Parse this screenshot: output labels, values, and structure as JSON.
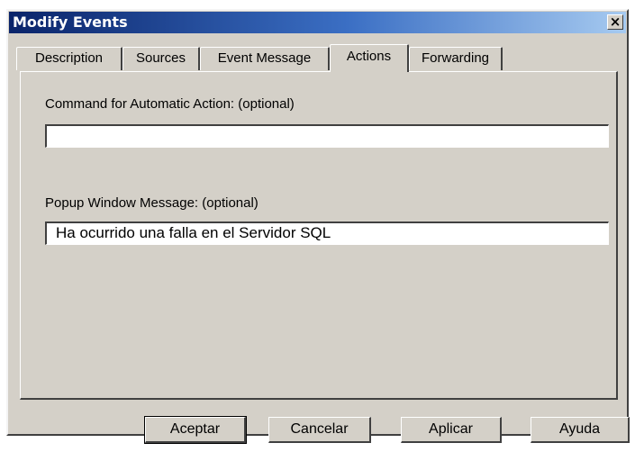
{
  "window": {
    "title": "Modify Events",
    "close_glyph": "×"
  },
  "tabs": [
    {
      "label": "Description",
      "active": false
    },
    {
      "label": "Sources",
      "active": false
    },
    {
      "label": "Event Message",
      "active": false
    },
    {
      "label": "Actions",
      "active": true
    },
    {
      "label": "Forwarding",
      "active": false
    }
  ],
  "actions": {
    "command_label": "Command for Automatic Action: (optional)",
    "command_value": "",
    "popup_label": "Popup Window Message: (optional)",
    "popup_value": "Ha ocurrido una falla en el Servidor SQL"
  },
  "buttons": {
    "ok": "Aceptar",
    "cancel": "Cancelar",
    "apply": "Aplicar",
    "help": "Ayuda"
  },
  "colors": {
    "dialog_bg": "#d4d0c8",
    "titlebar_start": "#0a246a",
    "titlebar_end": "#a6caf0"
  }
}
